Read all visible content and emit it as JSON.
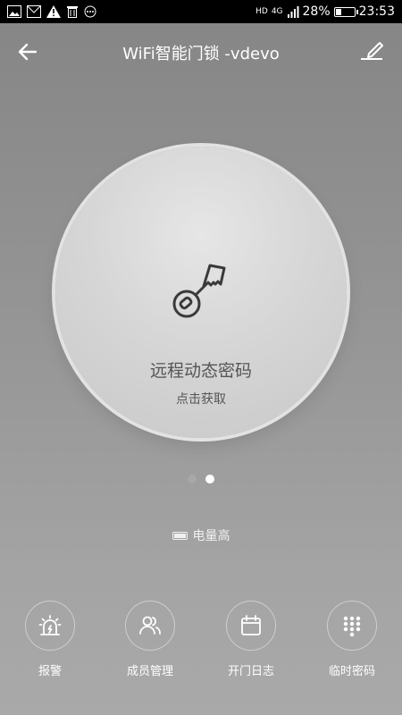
{
  "status_bar": {
    "net_hd": "HD",
    "net_4g": "4G",
    "battery_percent_label": "28%",
    "battery_level": 0.28,
    "time": "23:53"
  },
  "header": {
    "title": "WiFi智能门锁 -vdevo"
  },
  "main": {
    "title": "远程动态密码",
    "subtitle": "点击获取"
  },
  "pager": {
    "total_pages": 2,
    "current_page": 2
  },
  "power": {
    "label": "电量高",
    "level": 0.9
  },
  "actions": [
    {
      "label": "报警",
      "icon": "alarm-icon"
    },
    {
      "label": "成员管理",
      "icon": "members-icon"
    },
    {
      "label": "开门日志",
      "icon": "calendar-icon"
    },
    {
      "label": "临时密码",
      "icon": "keypad-icon"
    }
  ]
}
